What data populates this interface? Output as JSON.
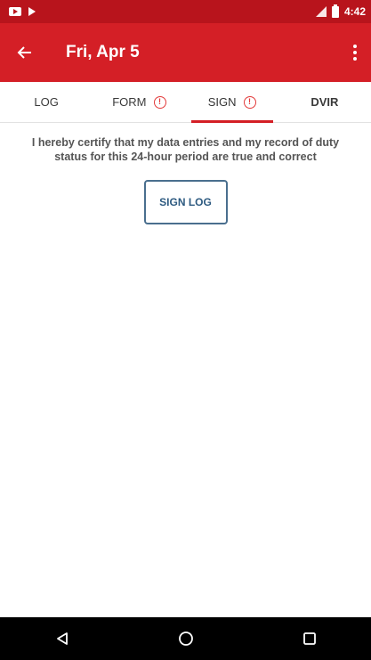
{
  "status_bar": {
    "time": "4:42",
    "icons": [
      "notification-icon",
      "play-store-icon",
      "signal-icon",
      "battery-icon"
    ]
  },
  "app_bar": {
    "title": "Fri, Apr 5",
    "back_icon": "arrow-left-icon",
    "menu_icon": "more-vert-icon"
  },
  "tabs": [
    {
      "label": "LOG",
      "alert": false,
      "active": false
    },
    {
      "label": "FORM",
      "alert": true,
      "active": false
    },
    {
      "label": "SIGN",
      "alert": true,
      "active": true
    },
    {
      "label": "DVIR",
      "alert": false,
      "active": false
    }
  ],
  "main": {
    "certify_text": "I hereby certify that my data entries and my record of duty status for this 24-hour period are true and correct",
    "sign_button_label": "SIGN LOG"
  },
  "nav_bar": {
    "icons": [
      "nav-back-icon",
      "nav-home-icon",
      "nav-recents-icon"
    ]
  },
  "colors": {
    "status_bar": "#b8141c",
    "app_bar": "#d41f26",
    "tab_indicator": "#d41f26",
    "alert": "#e23a3a",
    "button_border": "#4a6f8e"
  }
}
